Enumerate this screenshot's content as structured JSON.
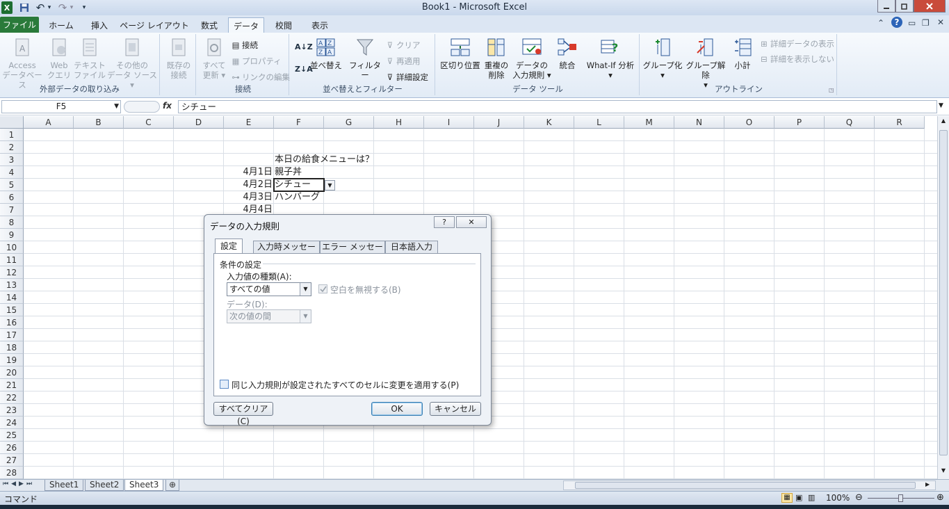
{
  "window": {
    "title": "Book1 - Microsoft Excel"
  },
  "qat": {
    "logo": "X",
    "save_icon": "save-icon",
    "undo": "↶",
    "redo": "↷",
    "more": "▾"
  },
  "ribbon_tabs": [
    "ファイル",
    "ホーム",
    "挿入",
    "ページ レイアウト",
    "数式",
    "データ",
    "校閲",
    "表示"
  ],
  "ribbon": {
    "groups": [
      "外部データの取り込み",
      "接続",
      "並べ替えとフィルター",
      "データ ツール",
      "アウトライン"
    ],
    "ext": [
      {
        "l1": "Access",
        "l2": "データベース"
      },
      {
        "l1": "Web",
        "l2": "クエリ"
      },
      {
        "l1": "テキスト",
        "l2": "ファイル"
      },
      {
        "l1": "その他の",
        "l2": "データ ソース ▾"
      },
      {
        "l1": "既存の",
        "l2": "接続"
      }
    ],
    "conn": {
      "refresh_l1": "すべて",
      "refresh_l2": "更新 ▾",
      "connect": "接続",
      "props": "プロパティ",
      "links": "リンクの編集"
    },
    "sort": {
      "sort": "並べ替え",
      "filter": "フィルター",
      "clear": "クリア",
      "reapply": "再適用",
      "advanced": "詳細設定"
    },
    "tools": {
      "split": "区切り位置",
      "dup_l1": "重複の",
      "dup_l2": "削除",
      "val_l1": "データの",
      "val_l2": "入力規則 ▾",
      "consolidate": "統合",
      "whatif": "What-If 分析",
      "whatif_arrow": "▾"
    },
    "outline": {
      "group": "グループ化",
      "ungroup": "グループ解除",
      "subtotal": "小計",
      "show": "詳細データの表示",
      "hide": "詳細を表示しない",
      "arrow": "▾"
    }
  },
  "formula_bar": {
    "cell": "F5",
    "fx": "fx",
    "value": "シチュー"
  },
  "columns": [
    "A",
    "B",
    "C",
    "D",
    "E",
    "F",
    "G",
    "H",
    "I",
    "J",
    "K",
    "L",
    "M",
    "N",
    "O",
    "P",
    "Q",
    "R"
  ],
  "rows": [
    "1",
    "2",
    "3",
    "4",
    "5",
    "6",
    "7",
    "8",
    "9",
    "10",
    "11",
    "12",
    "13",
    "14",
    "15",
    "16",
    "17",
    "18",
    "19",
    "20",
    "21",
    "22",
    "23",
    "24",
    "25",
    "26",
    "27",
    "28"
  ],
  "cells": {
    "F3": "本日の給食メニューは？",
    "E4": "4月1日",
    "F4": "親子丼",
    "E5": "4月2日",
    "F5": "シチュー",
    "E6": "4月3日",
    "F6": "ハンバーグ",
    "E7": "4月4日"
  },
  "sheets": [
    "Sheet1",
    "Sheet2",
    "Sheet3"
  ],
  "status": {
    "mode": "コマンド",
    "zoom": "100%"
  },
  "dialog": {
    "title": "データの入力規則",
    "help": "?",
    "close": "✕",
    "tabs": [
      "設定",
      "入力時メッセージ",
      "エラー メッセージ",
      "日本語入力"
    ],
    "section": "条件の設定",
    "allow_label": "入力値の種類(A):",
    "allow_value": "すべての値",
    "ignore_blank": "空白を無視する(B)",
    "data_label": "データ(D):",
    "data_value": "次の値の間",
    "apply_all": "同じ入力規則が設定されたすべてのセルに変更を適用する(P)",
    "clear_all": "すべてクリア(C)",
    "ok": "OK",
    "cancel": "キャンセル"
  }
}
